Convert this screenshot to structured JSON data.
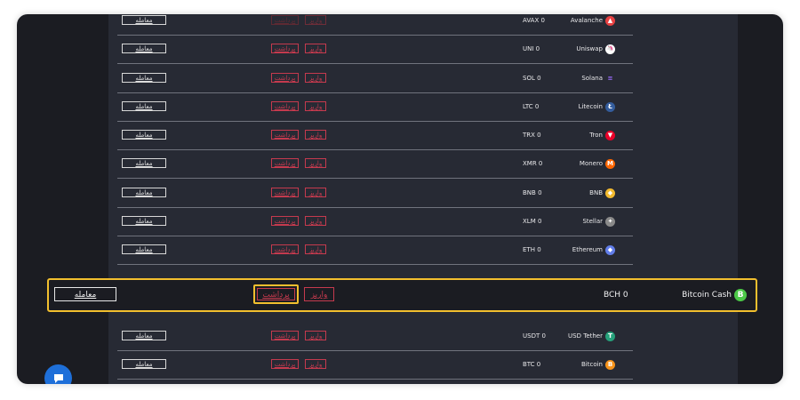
{
  "labels": {
    "trade": "معامله",
    "withdraw": "برداشت",
    "deposit": "واریز"
  },
  "rows": [
    {
      "name": "Avalanche",
      "balance": "AVAX 0",
      "icon": "avalanche-icon",
      "color": "#e84142",
      "glyph": "▲",
      "disabled": true
    },
    {
      "name": "Uniswap",
      "balance": "UNI 0",
      "icon": "uniswap-icon",
      "color": "#ffffff",
      "glyph": "🦄",
      "disabled": false
    },
    {
      "name": "Solana",
      "balance": "SOL 0",
      "icon": "solana-icon",
      "color": "transparent",
      "glyph": "≡",
      "disabled": false
    },
    {
      "name": "Litecoin",
      "balance": "LTC 0",
      "icon": "litecoin-icon",
      "color": "#345d9d",
      "glyph": "Ł",
      "disabled": false
    },
    {
      "name": "Tron",
      "balance": "TRX 0",
      "icon": "tron-icon",
      "color": "#eb0029",
      "glyph": "▼",
      "disabled": false
    },
    {
      "name": "Monero",
      "balance": "XMR 0",
      "icon": "monero-icon",
      "color": "#ff6600",
      "glyph": "M",
      "disabled": false
    },
    {
      "name": "BNB",
      "balance": "BNB 0",
      "icon": "bnb-icon",
      "color": "#f3ba2f",
      "glyph": "◆",
      "disabled": false
    },
    {
      "name": "Stellar",
      "balance": "XLM 0",
      "icon": "stellar-icon",
      "color": "#8a8a8a",
      "glyph": "✦",
      "disabled": false
    },
    {
      "name": "Ethereum",
      "balance": "ETH 0",
      "icon": "ethereum-icon",
      "color": "#627eea",
      "glyph": "◆",
      "disabled": false
    },
    {
      "name": "USD Tether",
      "balance": "USDT 0",
      "icon": "tether-icon",
      "color": "#26a17b",
      "glyph": "T",
      "disabled": false
    },
    {
      "name": "Bitcoin",
      "balance": "BTC 0",
      "icon": "bitcoin-icon",
      "color": "#f7931a",
      "glyph": "B",
      "disabled": false
    }
  ],
  "highlight": {
    "name": "Bitcoin Cash",
    "balance": "BCH 0",
    "icon": "bitcoin-cash-icon",
    "color": "#4cc947",
    "glyph": "B"
  },
  "chat": {
    "icon": "chat-icon"
  }
}
